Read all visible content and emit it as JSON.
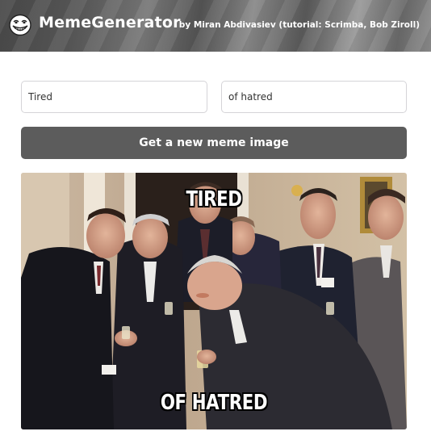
{
  "header": {
    "app_title": "MemeGenerator",
    "byline": "by Miran Abdivasiev (tutorial: Scrimba, Bob Ziroll)",
    "logo_icon": "trollface-icon"
  },
  "form": {
    "top_text_value": "Tired",
    "bottom_text_value": "of hatred",
    "button_label": "Get a new meme image"
  },
  "meme": {
    "image_subject": "laughing-men-in-suits",
    "top_caption": "Tired",
    "bottom_caption": "of hatred"
  },
  "colors": {
    "button": "#5c5c5c",
    "caption_fill": "#ffffff",
    "caption_outline": "#000000"
  }
}
